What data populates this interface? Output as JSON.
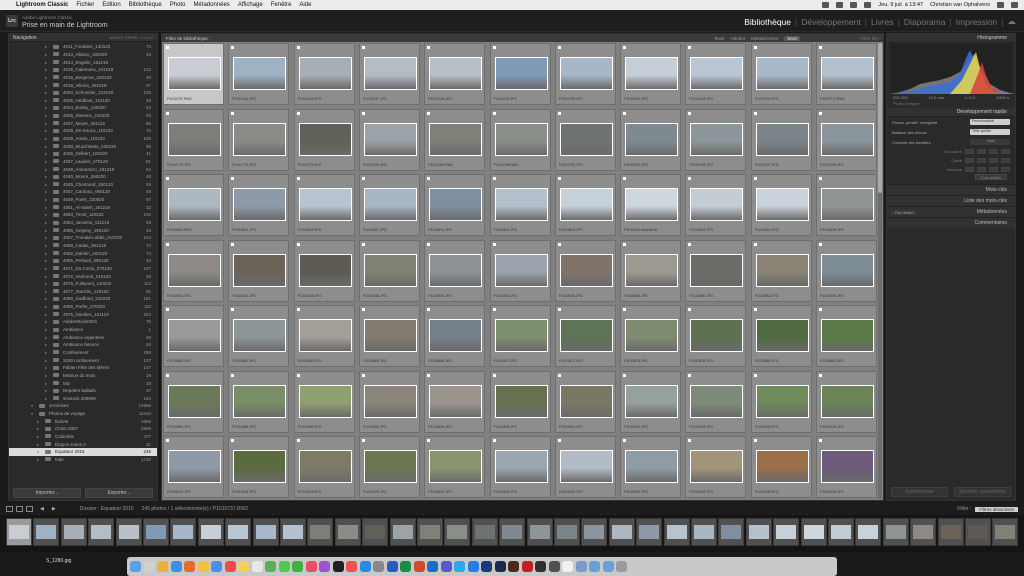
{
  "menubar": {
    "app_name": "Lightroom Classic",
    "menus": [
      "Fichier",
      "Edition",
      "Bibliothèque",
      "Photo",
      "Métadonnées",
      "Affichage",
      "Fenêtre",
      "Aide"
    ],
    "clock": "Jeu. 9 juil. à 13:47",
    "user": "Christian van Ophalvens"
  },
  "topbar": {
    "logo_text": "Lrc",
    "app_label": "Adobe Lightroom Classic",
    "catalog_title": "Prise en main de Lightroom"
  },
  "modules": [
    "Bibliothèque",
    "Développement",
    "Livres",
    "Diaporama",
    "Impression"
  ],
  "left_panel": {
    "navigation_title": "Navigation",
    "nav_options": "ADAPT. REMPL. 1:1 3:1",
    "import_label": "Importer...",
    "export_label": "Exporter...",
    "folders": [
      {
        "name": "4011_Fontaine_140120",
        "count": "70",
        "level": "sub"
      },
      {
        "name": "4013_Albano_190220",
        "count": "45",
        "level": "sub"
      },
      {
        "name": "4014_Engelin_191219",
        "count": "",
        "level": "sub"
      },
      {
        "name": "4015_Calemans_241019",
        "count": "142",
        "level": "sub"
      },
      {
        "name": "4016_Bergeron_220120",
        "count": "40",
        "level": "sub"
      },
      {
        "name": "4018_Villoria_281019",
        "count": "97",
        "level": "sub"
      },
      {
        "name": "4020_Schneider_211019",
        "count": "105",
        "level": "sub"
      },
      {
        "name": "4025_Hedbaut_110120",
        "count": "19",
        "level": "sub"
      },
      {
        "name": "4024_Bodey_130220",
        "count": "54",
        "level": "sub"
      },
      {
        "name": "4026_Stevens_210220",
        "count": "25",
        "level": "sub"
      },
      {
        "name": "4027_Meyer_281119",
        "count": "86",
        "level": "sub"
      },
      {
        "name": "4028_De-Souza_110120",
        "count": "75",
        "level": "sub"
      },
      {
        "name": "4029_Aredo_110120",
        "count": "105",
        "level": "sub"
      },
      {
        "name": "4030_Muschketto_230220",
        "count": "95",
        "level": "sub"
      },
      {
        "name": "4036_Delbert_100220",
        "count": "41",
        "level": "sub"
      },
      {
        "name": "4037_Lauden_270120",
        "count": "81",
        "level": "sub"
      },
      {
        "name": "4038_Antonazzo_181219",
        "count": "64",
        "level": "sub"
      },
      {
        "name": "4040_Moore_260220",
        "count": "48",
        "level": "sub"
      },
      {
        "name": "4045_Chartrand_160120",
        "count": "65",
        "level": "sub"
      },
      {
        "name": "4047_Cardoso_060120",
        "count": "49",
        "level": "sub"
      },
      {
        "name": "4049_Poels_220820",
        "count": "67",
        "level": "sub"
      },
      {
        "name": "4051_Al-Saleh_181219",
        "count": "32",
        "level": "sub"
      },
      {
        "name": "4053_Timol_110220",
        "count": "102",
        "level": "sub"
      },
      {
        "name": "4054_Jansens_111219",
        "count": "49",
        "level": "sub"
      },
      {
        "name": "4055_Gegeny_150120",
        "count": "45",
        "level": "sub"
      },
      {
        "name": "4057_Tronald-Labbé_010720",
        "count": "104",
        "level": "sub"
      },
      {
        "name": "4058_Cadas_301219",
        "count": "72",
        "level": "sub"
      },
      {
        "name": "4062_Dahlen_160120",
        "count": "74",
        "level": "sub"
      },
      {
        "name": "4065_Perlaud_080120",
        "count": "34",
        "level": "sub"
      },
      {
        "name": "4071_Da Costa_070120",
        "count": "107",
        "level": "sub"
      },
      {
        "name": "4072_Vanhorst_010120",
        "count": "39",
        "level": "sub"
      },
      {
        "name": "4076_Fullepont_110220",
        "count": "113",
        "level": "sub"
      },
      {
        "name": "4077_Stücklin_120120",
        "count": "91",
        "level": "sub"
      },
      {
        "name": "4080_Gadfroid_220220",
        "count": "181",
        "level": "sub"
      },
      {
        "name": "4096_Parfet_070320",
        "count": "110",
        "level": "sub"
      },
      {
        "name": "4975_Noelkes_151119",
        "count": "204",
        "level": "sub"
      },
      {
        "name": "AdobeStock0001",
        "count": "75",
        "level": "sub"
      },
      {
        "name": "Ambiance",
        "count": "1",
        "level": "sub"
      },
      {
        "name": "Ambiance argenterie",
        "count": "49",
        "level": "sub"
      },
      {
        "name": "Ambiance faïence",
        "count": "46",
        "level": "sub"
      },
      {
        "name": "Confinement",
        "count": "295",
        "level": "sub"
      },
      {
        "name": "2150 confinement",
        "count": "137",
        "level": "sub"
      },
      {
        "name": "Fabien Fête des Mères",
        "count": "147",
        "level": "sub"
      },
      {
        "name": "Mission du mois",
        "count": "19",
        "level": "sub"
      },
      {
        "name": "Moi",
        "count": "18",
        "level": "sub"
      },
      {
        "name": "Nepdere ballads",
        "count": "47",
        "level": "sub"
      },
      {
        "name": "smstock 200609",
        "count": "163",
        "level": "sub"
      },
      {
        "name": "4Archives",
        "count": "14566",
        "level": "top"
      },
      {
        "name": "Photos de voyage",
        "count": "11410",
        "level": "top"
      },
      {
        "name": "Bolivie",
        "count": "1689",
        "level": "mid"
      },
      {
        "name": "Chine 2007",
        "count": "2666",
        "level": "mid"
      },
      {
        "name": "Colombie",
        "count": "477",
        "level": "mid"
      },
      {
        "name": "Diapos scans 2",
        "count": "31",
        "level": "mid"
      },
      {
        "name": "Equateur 2015",
        "count": "245",
        "level": "mid",
        "selected": true
      },
      {
        "name": "Inde",
        "count": "1730",
        "level": "mid"
      }
    ]
  },
  "filter_bar": {
    "title": "Filtre de bibliothèque :",
    "options": [
      "Texte",
      "Attribut",
      "Métadonnées",
      "Sans"
    ],
    "active": "Sans",
    "preset": "Filtre dés"
  },
  "grid": {
    "rows": [
      [
        "P1010737.RW2",
        "P1010744.JPG",
        "P1010746.JPG",
        "P1010747.JPG",
        "P1010749.JPG",
        "P1010752.JPG",
        "P1010755.JPG",
        "P1010760.JPG",
        "P1010762.JPG",
        "P1010765.JPG",
        "P1010771.RW2"
      ],
      [
        "P1010775.JPG",
        "P1010776.JPG",
        "P1010778.JPG",
        "P1010780.JPG",
        "P1010785.RW2",
        "P1010788.RW2",
        "P1010790.JPG",
        "P1010793.JPG",
        "P1010795.JPG",
        "P1010797.JPG",
        "P1010798.JPG"
      ],
      [
        "P1010800.RW2",
        "P1010802.JPG",
        "P1010805.JPG",
        "P1010807.JPG",
        "P1010811.JPG",
        "P1010814.JPG",
        "P1010818.JPG",
        "P1010820-Modifier.tif",
        "P1010822.JPG",
        "P1010824.JPG",
        "P1010826.JPG"
      ],
      [
        "P1010830.JPG",
        "P1010832.JPG",
        "P1010835.JPG",
        "P1010838.JPG",
        "P1010840.JPG",
        "P1010842.JPG",
        "P1010845.JPG",
        "P1010848.JPG",
        "P1010850.JPG",
        "P1010852.JPG",
        "P1010855.JPG"
      ],
      [
        "P1010858.JPG",
        "P1010860.JPG",
        "P1010863.JPG",
        "P1010865.JPG",
        "P1010868.JPG",
        "P1010870.JPG",
        "P1010872.JPG",
        "P1010875.JPG",
        "P1010878.JPG",
        "P1010880.JPG",
        "P1010882.JPG"
      ],
      [
        "P1010885.JPG",
        "P1010888.JPG",
        "P1010890.JPG",
        "P1010892.JPG",
        "P1010895.JPG",
        "P1010898.JPG",
        "P1010900.JPG",
        "P1010902.JPG",
        "P1010905.JPG",
        "P1010908.JPG",
        "P1010910.JPG"
      ],
      [
        "P1010912.JPG",
        "P1010915.JPG",
        "P1010918.JPG",
        "P1010920.JPG",
        "P1010922.JPG",
        "P1010925.JPG",
        "P1010928.JPG",
        "P1010930.JPG",
        "P1010932.JPG",
        "P1010935.JPG",
        "P1010938.JPG"
      ]
    ],
    "thumb_colors": [
      [
        "#c9cdd3",
        "#9fb2c4",
        "#a8aeb6",
        "#b4bcc4",
        "#b9bfc6",
        "#7f9bb7",
        "#a7b7c7",
        "#c6cfd8",
        "#b9c6d3",
        "#aab9c9",
        "#b3c0cd"
      ],
      [
        "#7c7e78",
        "#8a8d87",
        "#5e6258",
        "#9ca3a8",
        "#7d8177",
        "#8a8e88",
        "#6f7370",
        "#7e8a90",
        "#8d969a",
        "#7b8489",
        "#8a959d"
      ],
      [
        "#aeb8c2",
        "#8e9aa8",
        "#b7c3cf",
        "#a9b6c3",
        "#7f8f9f",
        "#b4c1cd",
        "#c6d0d9",
        "#cfd7de",
        "#c4ccd4",
        "#c9d2da",
        "#8f9691"
      ],
      [
        "#8d8a86",
        "#6b6258",
        "#5d5a54",
        "#7e8272",
        "#8e9296",
        "#9aa3ab",
        "#80736a",
        "#9e9991",
        "#6c6b66",
        "#8a8376",
        "#7d8c95"
      ],
      [
        "#999",
        "#8f969a",
        "#a39e97",
        "#837a70",
        "#757f8a",
        "#7e8f70",
        "#5f7355",
        "#7f8c70",
        "#5d7150",
        "#4f6a40",
        "#5b7a48"
      ],
      [
        "#6a7a58",
        "#7a8e68",
        "#8ea070",
        "#8b857c",
        "#9a948c",
        "#66714f",
        "#7a7764",
        "#96a09c",
        "#7e8a7a",
        "#6e8b5a",
        "#6b8558"
      ],
      [
        "#8f9aa6",
        "#5a6b40",
        "#7f7a66",
        "#6a7750",
        "#8a946e",
        "#9ba6b0",
        "#b3bcc5",
        "#8f9ca6",
        "#a3937a",
        "#9a6f4a",
        "#6e5a7a"
      ]
    ]
  },
  "right_panel": {
    "histogram_title": "Histogramme",
    "histo_info": [
      "ISO 200",
      "19,2 mm",
      "f / 6,3",
      "1/320 s"
    ],
    "original_photo": "Photo d'origine",
    "quick_develop_title": "Développement rapide",
    "preset_label": "Param. prédéf. enregistré",
    "preset_value": "Personnalisé",
    "white_balance_label": "Balance des blancs",
    "white_balance_value": "Telle quelle",
    "tone_label": "Contrôle des tonalités",
    "auto_label": "Auto",
    "sliders": [
      "Exposition",
      "Clarté",
      "Vibrance"
    ],
    "reset_label": "Tout rétablir",
    "sections": [
      "Mots-clés",
      "Liste des mots-clés",
      "Métadonnées",
      "Commentaires"
    ],
    "metadata_preset": "Par défaut",
    "sync_label": "Synchroniser",
    "sync_settings_label": "Synchro. paramètres"
  },
  "toolbar": {
    "source": "Dossier : Equateur 2015",
    "count": "245 photos / 1 sélectionnée(s) / P1010737.RW2",
    "filter_label": "Filtre :",
    "filter_value": "Filtres désactivés"
  },
  "desktop": {
    "file_label": "S_1280.jpg"
  },
  "colors": {
    "accent": "#ffffff",
    "panel": "#2a2a2a",
    "grid_bg": "#808080",
    "histogram_blue": "#3c6fd8",
    "histogram_yellow": "#e8d84a",
    "histogram_red": "#d8403a"
  },
  "dock_icons": [
    "finder-icon",
    "launchpad-icon",
    "chrome-icon",
    "safari-icon",
    "firefox-icon",
    "photos-icon",
    "mail-icon",
    "calendar-icon",
    "notes-icon",
    "reminders-icon",
    "maps-icon",
    "messages-icon",
    "facetime-icon",
    "music-icon",
    "podcasts-icon",
    "tv-icon",
    "news-icon",
    "appstore-icon",
    "preferences-icon",
    "word-icon",
    "excel-icon",
    "powerpoint-icon",
    "outlook-icon",
    "teams-icon",
    "skype-icon",
    "zoom-icon",
    "photoshop-icon",
    "lightroom-icon",
    "bridge-icon",
    "acrobat-icon",
    "terminal-icon",
    "activity-icon",
    "textedit-icon",
    "preview-icon",
    "folder-icon",
    "folder-icon",
    "trash-icon"
  ]
}
